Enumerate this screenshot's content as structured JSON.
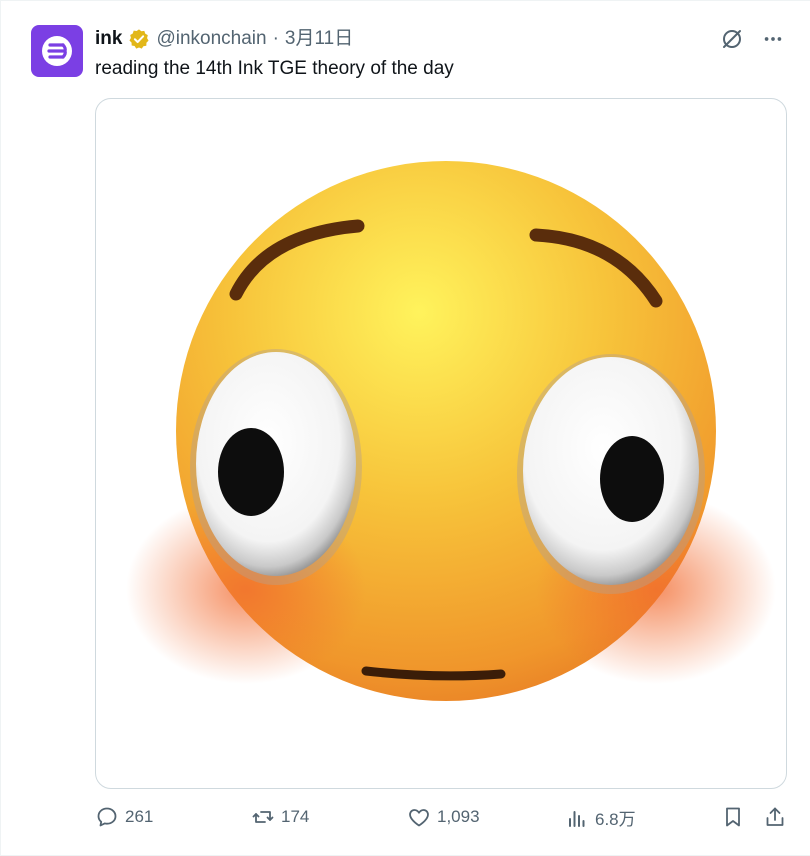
{
  "tweet": {
    "author_name": "ink",
    "handle": "@inkonchain",
    "separator": "·",
    "date": "3月11日",
    "text": "reading the 14th Ink TGE theory of the day",
    "avatar_icon": "ink-logo-icon",
    "verified_icon": "verified-badge-icon",
    "brand_color": "#7b3fe4",
    "badge_color": "#e2b719"
  },
  "top_actions": {
    "grok_icon": "grok-icon",
    "more_icon": "more-icon"
  },
  "media": {
    "icon": "flushed-face-emoji"
  },
  "stats": {
    "replies": "261",
    "reposts": "174",
    "likes": "1,093",
    "views": "6.8万"
  },
  "colors": {
    "text_primary": "#0f1419",
    "text_secondary": "#536471",
    "border": "#cfd9de"
  }
}
